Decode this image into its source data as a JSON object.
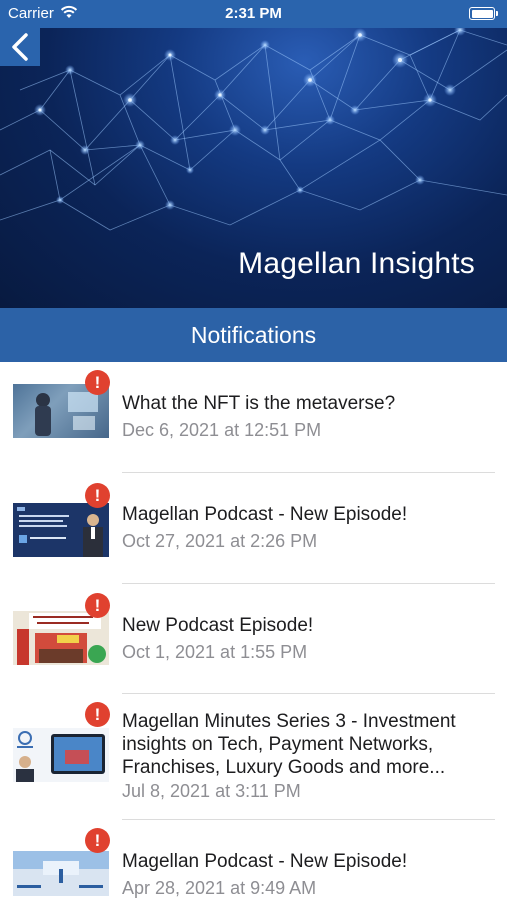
{
  "status_bar": {
    "carrier": "Carrier",
    "time": "2:31 PM"
  },
  "header": {
    "title": "Magellan Insights",
    "back_icon": "chevron-left-icon"
  },
  "section": {
    "title": "Notifications"
  },
  "notifications": [
    {
      "title": "What the NFT is the metaverse?",
      "date": "Dec 6, 2021 at 12:51 PM",
      "unread_badge": "!"
    },
    {
      "title": "Magellan Podcast - New Episode!",
      "date": "Oct 27, 2021 at 2:26 PM",
      "unread_badge": "!"
    },
    {
      "title": "New Podcast Episode!",
      "date": "Oct 1, 2021 at 1:55 PM",
      "unread_badge": "!"
    },
    {
      "title": "Magellan Minutes Series 3 - Investment insights on Tech, Payment Networks, Franchises, Luxury Goods and more...",
      "date": "Jul 8, 2021 at 3:11 PM",
      "unread_badge": "!"
    },
    {
      "title": "Magellan Podcast - New Episode!",
      "date": "Apr 28, 2021 at 9:49 AM",
      "unread_badge": "!"
    }
  ],
  "colors": {
    "primary": "#2c62a7",
    "badge": "#e0412f",
    "date_text": "#8e8e93"
  }
}
